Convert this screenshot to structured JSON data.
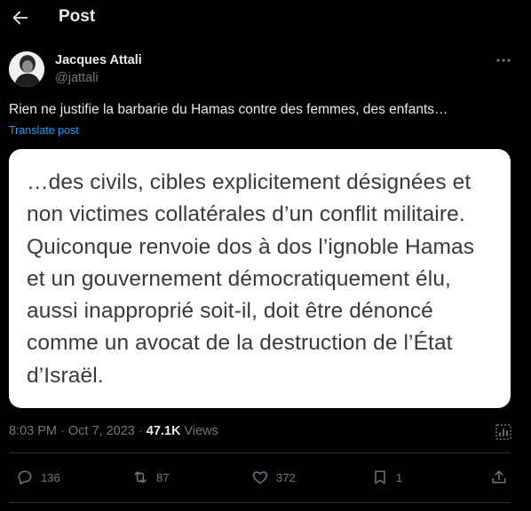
{
  "header": {
    "title": "Post",
    "back_icon": "arrow-left-icon"
  },
  "author": {
    "name": "Jacques Attali",
    "handle": "@jattali",
    "more_icon": "ellipsis-icon"
  },
  "tweet": {
    "text": "Rien ne justifie la barbarie du Hamas contre des femmes, des enfants…",
    "translate_label": "Translate post",
    "image_text_lines": [
      "…des civils, cibles explicitement désignées et",
      "non victimes collatérales d’un conflit militaire.",
      "Quiconque renvoie dos à dos l’ignoble Hamas",
      "et un gouvernement démocratiquement élu,",
      "aussi inapproprié soit-il, doit être dénoncé",
      "comme un avocat de la destruction de l’État",
      "d’Israël."
    ]
  },
  "meta": {
    "time": "8:03 PM",
    "separator": " · ",
    "date": "Oct 7, 2023",
    "views_sep": " · ",
    "views_count": "47.1K",
    "views_label": " Views"
  },
  "actions": {
    "reply_count": "136",
    "retweet_count": "87",
    "like_count": "372",
    "bookmark_count": "1"
  },
  "colors": {
    "accent": "#1d9bf0",
    "muted": "#71767b",
    "text": "#e7e9ea",
    "background": "#000000"
  }
}
